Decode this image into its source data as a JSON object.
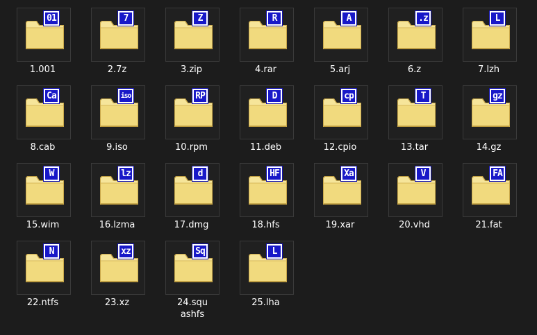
{
  "items": [
    {
      "badge": "01",
      "name": "1.001"
    },
    {
      "badge": "7",
      "name": "2.7z"
    },
    {
      "badge": "Z",
      "name": "3.zip"
    },
    {
      "badge": "R",
      "name": "4.rar"
    },
    {
      "badge": "A",
      "name": "5.arj"
    },
    {
      "badge": ".z",
      "name": "6.z"
    },
    {
      "badge": "L",
      "name": "7.lzh"
    },
    {
      "badge": "Ca",
      "name": "8.cab"
    },
    {
      "badge": "iso",
      "name": "9.iso"
    },
    {
      "badge": "RP",
      "name": "10.rpm"
    },
    {
      "badge": "D",
      "name": "11.deb"
    },
    {
      "badge": "cp",
      "name": "12.cpio"
    },
    {
      "badge": "T",
      "name": "13.tar"
    },
    {
      "badge": "gz",
      "name": "14.gz"
    },
    {
      "badge": "W",
      "name": "15.wim"
    },
    {
      "badge": "lz",
      "name": "16.lzma"
    },
    {
      "badge": "d",
      "name": "17.dmg"
    },
    {
      "badge": "HF",
      "name": "18.hfs"
    },
    {
      "badge": "Xa",
      "name": "19.xar"
    },
    {
      "badge": "V",
      "name": "20.vhd"
    },
    {
      "badge": "FA",
      "name": "21.fat"
    },
    {
      "badge": "N",
      "name": "22.ntfs"
    },
    {
      "badge": "xz",
      "name": "23.xz"
    },
    {
      "badge": "Sq",
      "name": "24.squashfs"
    },
    {
      "badge": "L",
      "name": "25.lha"
    }
  ],
  "colors": {
    "background": "#1c1c1c",
    "badge_blue": "#1818c8",
    "folder_yellow": "#f3e08a"
  },
  "icons": {
    "folder": "folder-icon",
    "badge": "archive-badge-icon"
  }
}
